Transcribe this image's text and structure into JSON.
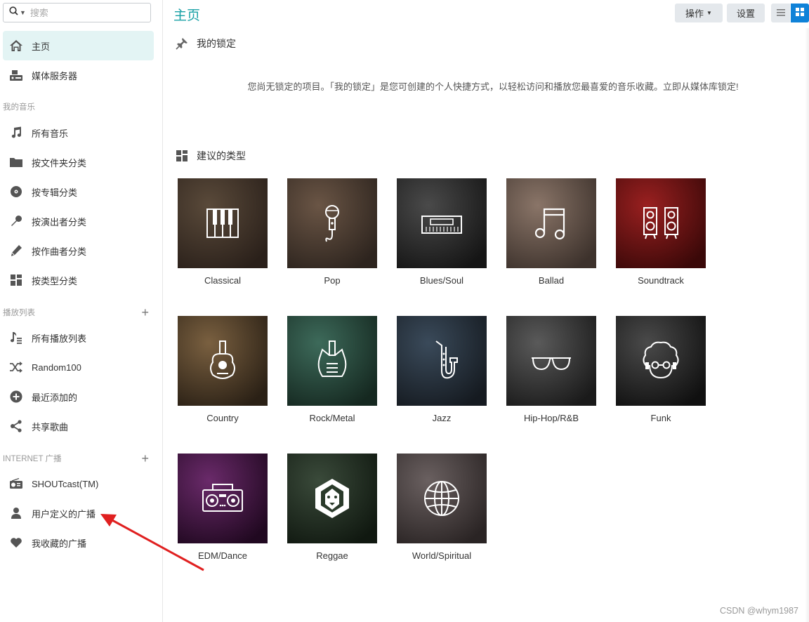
{
  "search": {
    "placeholder": "搜索"
  },
  "sidebar": {
    "top": [
      {
        "name": "home",
        "label": "主页",
        "icon": "home-icon",
        "active": true
      },
      {
        "name": "media-server",
        "label": "媒体服务器",
        "icon": "media-server-icon"
      }
    ],
    "my_music_header": "我的音乐",
    "my_music": [
      {
        "name": "all-music",
        "label": "所有音乐",
        "icon": "music-note-icon"
      },
      {
        "name": "by-folder",
        "label": "按文件夹分类",
        "icon": "folder-icon"
      },
      {
        "name": "by-album",
        "label": "按专辑分类",
        "icon": "disc-icon"
      },
      {
        "name": "by-artist",
        "label": "按演出者分类",
        "icon": "microphone-icon"
      },
      {
        "name": "by-composer",
        "label": "按作曲者分类",
        "icon": "pen-icon"
      },
      {
        "name": "by-genre",
        "label": "按类型分类",
        "icon": "grid-icon"
      }
    ],
    "playlist_header": "播放列表",
    "playlists": [
      {
        "name": "all-playlists",
        "label": "所有播放列表",
        "icon": "playlist-icon"
      },
      {
        "name": "random100",
        "label": "Random100",
        "icon": "shuffle-icon"
      },
      {
        "name": "recently-added",
        "label": "最近添加的",
        "icon": "plus-circle-icon"
      },
      {
        "name": "shared-songs",
        "label": "共享歌曲",
        "icon": "share-icon"
      }
    ],
    "radio_header": "INTERNET 广播",
    "radio": [
      {
        "name": "shoutcast",
        "label": "SHOUTcast(TM)",
        "icon": "radio-icon"
      },
      {
        "name": "user-defined-radio",
        "label": "用户定义的广播",
        "icon": "user-icon"
      },
      {
        "name": "favorite-radio",
        "label": "我收藏的广播",
        "icon": "heart-icon"
      }
    ]
  },
  "header": {
    "title": "主页",
    "operations_label": "操作",
    "settings_label": "设置"
  },
  "pinned": {
    "title": "我的锁定",
    "empty_text": "您尚无锁定的项目。「我的锁定」是您可创建的个人快捷方式，以轻松访问和播放您最喜爱的音乐收藏。立即从媒体库锁定!"
  },
  "genres": {
    "title": "建议的类型",
    "items": [
      {
        "label": "Classical",
        "bg": [
          "#5a4a3a",
          "#2a201a"
        ],
        "icon": "piano-icon"
      },
      {
        "label": "Pop",
        "bg": [
          "#6a5545",
          "#2d241e"
        ],
        "icon": "microphone-icon"
      },
      {
        "label": "Blues/Soul",
        "bg": [
          "#4a4a4a",
          "#151515"
        ],
        "icon": "keyboard-icon"
      },
      {
        "label": "Ballad",
        "bg": [
          "#8a7568",
          "#3d322c"
        ],
        "icon": "music-note-icon"
      },
      {
        "label": "Soundtrack",
        "bg": [
          "#9a2020",
          "#3a0808"
        ],
        "icon": "speakers-icon"
      },
      {
        "label": "Country",
        "bg": [
          "#7a6040",
          "#2a2015"
        ],
        "icon": "guitar-icon"
      },
      {
        "label": "Rock/Metal",
        "bg": [
          "#3d6a5a",
          "#152820"
        ],
        "icon": "electric-guitar-icon"
      },
      {
        "label": "Jazz",
        "bg": [
          "#3a4a5a",
          "#151a20"
        ],
        "icon": "saxophone-icon"
      },
      {
        "label": "Hip-Hop/R&B",
        "bg": [
          "#5a5a5a",
          "#1a1a1a"
        ],
        "icon": "sunglasses-icon"
      },
      {
        "label": "Funk",
        "bg": [
          "#4a4a4a",
          "#101010"
        ],
        "icon": "afro-icon"
      },
      {
        "label": "EDM/Dance",
        "bg": [
          "#6a2a6a",
          "#200820"
        ],
        "icon": "boombox-icon"
      },
      {
        "label": "Reggae",
        "bg": [
          "#3a4a3a",
          "#101810"
        ],
        "icon": "lion-icon"
      },
      {
        "label": "World/Spiritual",
        "bg": [
          "#6a6060",
          "#2a2424"
        ],
        "icon": "globe-icon"
      }
    ]
  },
  "watermark": "CSDN @whym1987",
  "colors": {
    "accent": "#17a0a5",
    "active_bg": "#e3f4f4",
    "primary_button": "#0f82d8",
    "annotation_arrow": "#e02020"
  }
}
